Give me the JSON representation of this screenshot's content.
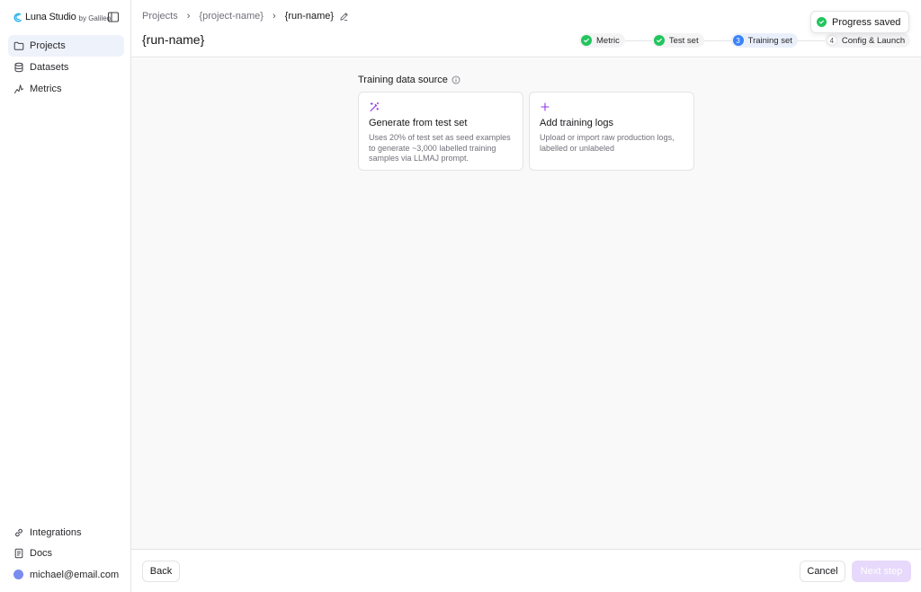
{
  "brand": {
    "name": "Luna Studio",
    "by": "by Galileo",
    "accent": "#0ea5e9"
  },
  "sidebar": {
    "items": [
      {
        "label": "Projects",
        "icon": "folder-icon",
        "active": true
      },
      {
        "label": "Datasets",
        "icon": "database-icon"
      },
      {
        "label": "Metrics",
        "icon": "metrics-icon"
      }
    ],
    "bottom": [
      {
        "label": "Integrations",
        "icon": "link-icon"
      },
      {
        "label": "Docs",
        "icon": "doc-icon"
      },
      {
        "label": "michael@email.com",
        "icon": "avatar"
      }
    ]
  },
  "breadcrumb": {
    "root": "Projects",
    "project": "{project-name}",
    "run": "{run-name}"
  },
  "page_title": "{run-name}",
  "stepper": {
    "steps": [
      {
        "label": "Metric",
        "state": "done"
      },
      {
        "label": "Test set",
        "state": "done"
      },
      {
        "num": "3",
        "label": "Training set",
        "state": "current"
      },
      {
        "num": "4",
        "label": "Config & Launch",
        "state": "todo"
      }
    ]
  },
  "toast": {
    "text": "Progress saved"
  },
  "main": {
    "section_label": "Training data source",
    "cards": [
      {
        "icon": "magic-wand-icon",
        "title": "Generate from test set",
        "desc": "Uses 20% of test set as seed examples to generate ~3,000 labelled training samples via LLMAJ prompt."
      },
      {
        "icon": "plus-icon",
        "title": "Add training logs",
        "desc": "Upload or import raw production logs, labelled or unlabeled"
      }
    ]
  },
  "footer": {
    "back_label": "Back",
    "cancel_label": "Cancel",
    "next_label": "Next step"
  },
  "colors": {
    "success": "#22c55e",
    "current_step": "#3b82f6",
    "purple_icon": "#9333ea",
    "next_disabled_bg": "#e7d9fb"
  }
}
